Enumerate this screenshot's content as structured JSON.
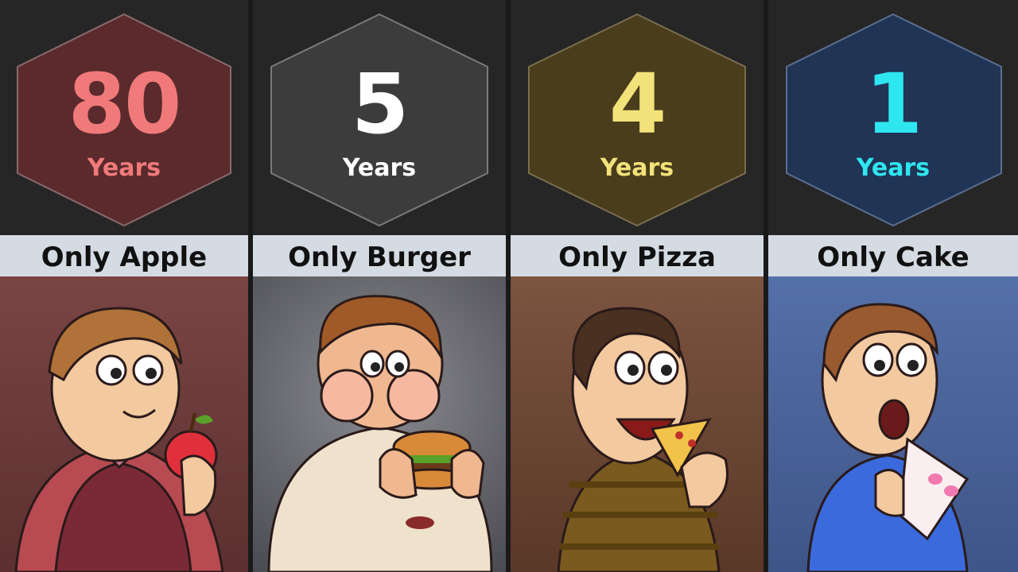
{
  "panels": [
    {
      "number": "80",
      "unit": "Years",
      "label": "Only Apple",
      "num_color": "#f07a7a",
      "hex_color": "#5a2a2c",
      "scene_bg": "#7a4444"
    },
    {
      "number": "5",
      "unit": "Years",
      "label": "Only Burger",
      "num_color": "#ffffff",
      "hex_color": "#3c3c3c",
      "scene_bg": "#6e6f73"
    },
    {
      "number": "4",
      "unit": "Years",
      "label": "Only Pizza",
      "num_color": "#f2e27a",
      "hex_color": "#4a3d1c",
      "scene_bg": "#7c5440"
    },
    {
      "number": "1",
      "unit": "Years",
      "label": "Only Cake",
      "num_color": "#2ee6f0",
      "hex_color": "#203456",
      "scene_bg": "#5470a8"
    }
  ]
}
